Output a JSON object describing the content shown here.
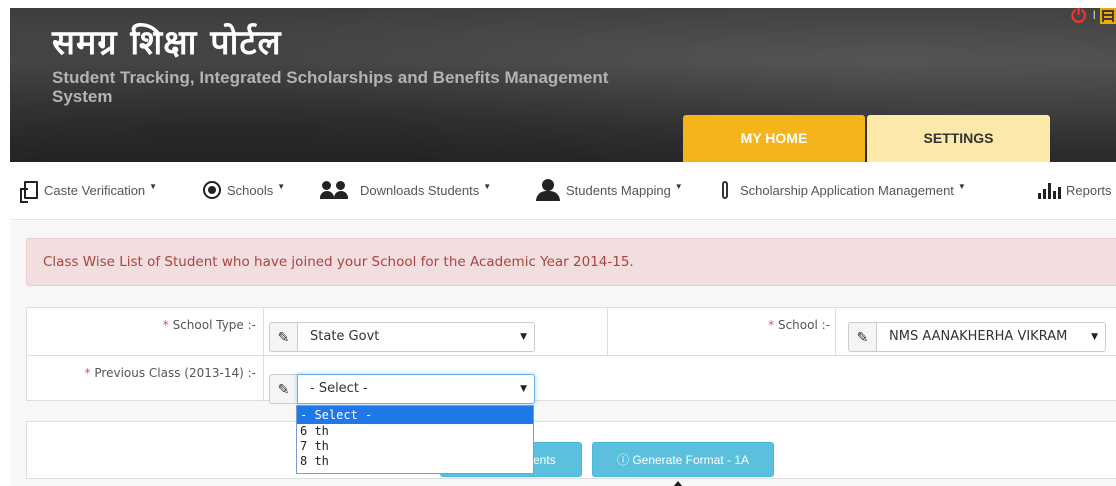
{
  "header": {
    "title": "समग्र शिक्षा पोर्टल",
    "subtitle": "Student Tracking, Integrated Scholarships and Benefits Management System",
    "tabs": [
      {
        "label": "MY HOME",
        "active": true
      },
      {
        "label": "SETTINGS",
        "active": false
      }
    ],
    "separator": "I",
    "colors": {
      "active_tab": "#f5b41a",
      "inactive_tab": "#fce8a9",
      "power": "#ff2e2e"
    }
  },
  "nav": {
    "items": [
      {
        "label": "Caste Verification",
        "icon": "document-icon"
      },
      {
        "label": "Schools",
        "icon": "target-icon"
      },
      {
        "label": "Downloads Students",
        "icon": "users-icon"
      },
      {
        "label": "Students Mapping",
        "icon": "user-icon"
      },
      {
        "label": "Scholarship Application Management",
        "icon": "paperclip-icon"
      },
      {
        "label": "Reports",
        "icon": "bar-chart-icon"
      }
    ]
  },
  "main": {
    "alert": "Class Wise List of Student who have joined your School for the Academic Year 2014-15.",
    "form": {
      "school_type": {
        "required_mark": "*",
        "label": "School Type :-",
        "value": "State Govt"
      },
      "school": {
        "required_mark": "*",
        "label": "School :-",
        "value": "NMS AANAKHERHA VIKRAM"
      },
      "previous_class": {
        "required_mark": "*",
        "label": "Previous Class (2013-14) :-",
        "value": "- Select -"
      }
    },
    "dropdown_options": [
      "- Select -",
      "6 th",
      "7 th",
      "8 th"
    ],
    "buttons": {
      "get_students": "dents",
      "generate_format": "Generate Format - 1A"
    },
    "colors": {
      "alert_bg": "#f2dede",
      "alert_text": "#a94442",
      "button": "#5bc0de",
      "option_selected": "#1e78e6"
    }
  }
}
